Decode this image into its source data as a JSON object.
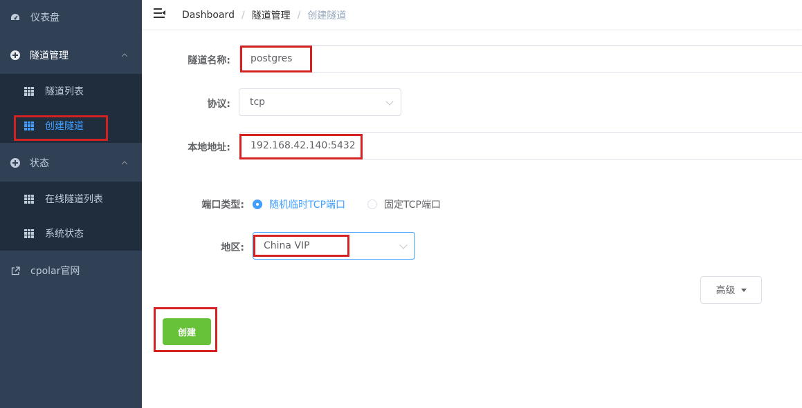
{
  "sidebar": {
    "items": [
      {
        "label": "仪表盘"
      },
      {
        "label": "隧道管理"
      },
      {
        "label": "隧道列表"
      },
      {
        "label": "创建隧道"
      },
      {
        "label": "状态"
      },
      {
        "label": "在线隧道列表"
      },
      {
        "label": "系统状态"
      },
      {
        "label": "cpolar官网"
      }
    ]
  },
  "header": {
    "breadcrumb": [
      "Dashboard",
      "隧道管理",
      "创建隧道"
    ],
    "separator": "/"
  },
  "form": {
    "name_label": "隧道名称:",
    "name_value": "postgres",
    "protocol_label": "协议:",
    "protocol_value": "tcp",
    "local_addr_label": "本地地址:",
    "local_addr_value": "192.168.42.140:5432",
    "port_type_label": "端口类型:",
    "port_type_options": [
      "随机临时TCP端口",
      "固定TCP端口"
    ],
    "region_label": "地区:",
    "region_value": "China VIP"
  },
  "buttons": {
    "advanced": "高级",
    "create": "创建"
  },
  "colors": {
    "sidebar_bg": "#304156",
    "submenu_bg": "#1f2d3d",
    "active": "#409eff",
    "create_btn": "#67c23a",
    "highlight": "#d42121"
  }
}
